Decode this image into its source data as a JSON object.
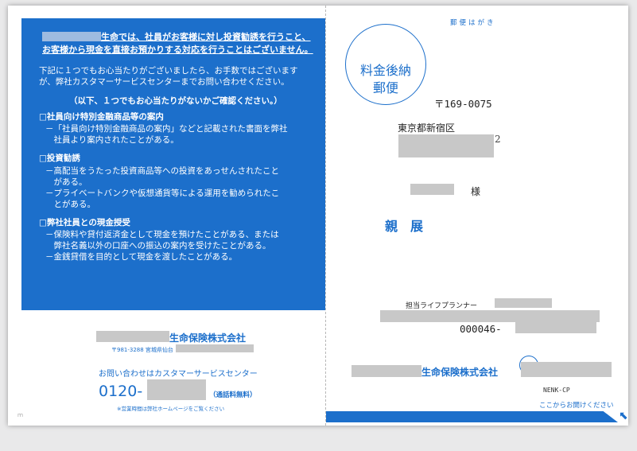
{
  "panel": {
    "heading_line1": "生命では、社員がお客様に対し投資勧誘を行うこと、",
    "heading_line2": "お客様から現金を直接お預かりする対応を行うことはございません。",
    "intro_line1": "下記に１つでもお心当たりがございましたら、お手数ではございます",
    "intro_line2": "が、弊社カスタマーサービスセンターまでお問い合わせください。",
    "check_note": "（以下、１つでもお心当たりがないかご確認ください。）",
    "sections": [
      {
        "title": "□社員向け特別金融商品等の案内",
        "lines": [
          "－「社員向け特別金融商品の案内」などと記載された書面を弊社",
          "　社員より案内されたことがある。"
        ]
      },
      {
        "title": "□投資勧誘",
        "lines": [
          "－高配当をうたった投資商品等への投資をあっせんされたこと",
          "　がある。",
          "－プライベートバンクや仮想通貨等による運用を勧められたこ",
          "　とがある。"
        ]
      },
      {
        "title": "□弊社社員との現金授受",
        "lines": [
          "－保険料や貸付返済金として現金を預けたことがある、または",
          "　弊社名義以外の口座への振込の案内を受けたことがある。",
          "－金銭貸借を目的として現金を渡したことがある。"
        ]
      }
    ]
  },
  "left_footer": {
    "company": "生命保険株式会社",
    "address": "〒981-3288 宮城県仙台",
    "contact_label": "お問い合わせはカスタマーサービスセンター",
    "phone_prefix": "0120-",
    "phone_note": "（通話料無料）",
    "hours_note": "※営業時間は弊社ホームページをご覧ください",
    "corner_mark": "ｍ"
  },
  "postcard": {
    "label": "郵便はがき",
    "stamp_line1": "料金後納",
    "stamp_line2": "郵便",
    "postal_code": "〒169-0075",
    "address_line1": "東京都新宿区",
    "address_line1_tail": "2",
    "recipient_suffix": "様",
    "shinten": "親　展",
    "planner_label": "担当ライフプランナー",
    "code": "000046-",
    "company": "生命保険株式会社",
    "form_code": "NENK-CP",
    "open_here": "ここからお開けください",
    "arrow": "⬉"
  },
  "colors": {
    "brand_blue": "#1c6fcb",
    "redaction": "#c8c8c8"
  }
}
